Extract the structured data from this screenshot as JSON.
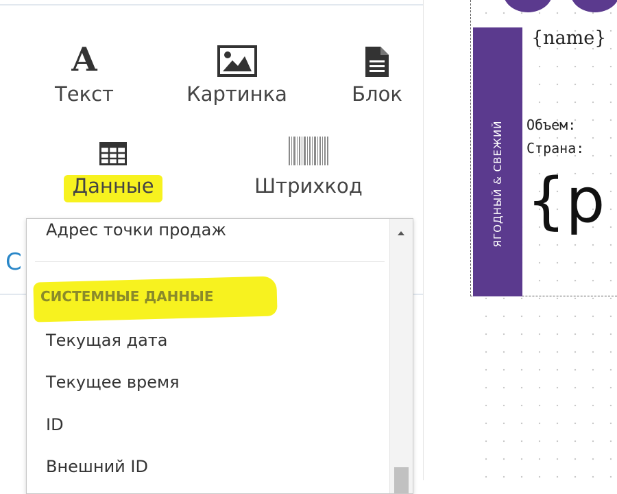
{
  "toolbar": {
    "tools": [
      {
        "id": "text",
        "label": "Текст",
        "icon": "letter-a-icon",
        "icon_glyph": "A"
      },
      {
        "id": "image",
        "label": "Картинка",
        "icon": "image-icon"
      },
      {
        "id": "block",
        "label": "Блок",
        "icon": "document-icon"
      },
      {
        "id": "data",
        "label": "Данные",
        "icon": "table-icon",
        "highlighted": true
      },
      {
        "id": "barcode",
        "label": "Штрихкод",
        "icon": "barcode-icon"
      }
    ],
    "side_letter": "C"
  },
  "dropdown": {
    "items_before": [
      "Адрес точки продаж"
    ],
    "group_label": "СИСТЕМНЫЕ ДАННЫЕ",
    "items": [
      "Текущая дата",
      "Текущее время",
      "ID",
      "Внешний ID"
    ]
  },
  "canvas": {
    "strip_text": "ЯГОДНЫЙ & СВЕЖИЙ",
    "name_placeholder": "{name}",
    "volume_label": "Объем:",
    "country_label": "Страна:",
    "price_placeholder": "{p"
  },
  "colors": {
    "highlight": "#f7f21f",
    "brand_purple": "#5b3a8e",
    "link_blue": "#2a87c8"
  }
}
